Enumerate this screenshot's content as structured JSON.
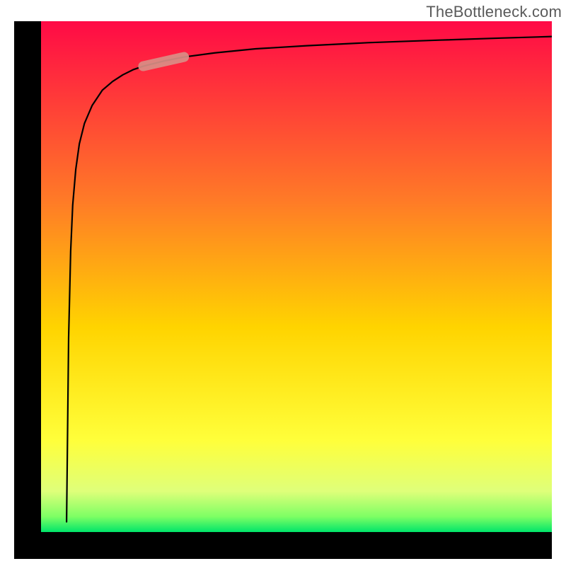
{
  "attribution": "TheBottleneck.com",
  "chart_data": {
    "type": "line",
    "title": "",
    "xlabel": "",
    "ylabel": "",
    "xlim": [
      0,
      100
    ],
    "ylim": [
      0,
      100
    ],
    "grid": false,
    "legend": false,
    "annotations": [],
    "background_gradient": {
      "direction": "vertical_top_to_bottom",
      "stops": [
        {
          "pos": 0.0,
          "color": "#ff0a46"
        },
        {
          "pos": 0.35,
          "color": "#ff7a27"
        },
        {
          "pos": 0.6,
          "color": "#ffd400"
        },
        {
          "pos": 0.82,
          "color": "#ffff3a"
        },
        {
          "pos": 0.92,
          "color": "#dfff7a"
        },
        {
          "pos": 0.97,
          "color": "#7dff64"
        },
        {
          "pos": 1.0,
          "color": "#00e56a"
        }
      ]
    },
    "series": [
      {
        "name": "curve",
        "x": [
          5.0,
          5.2,
          5.4,
          5.8,
          6.2,
          6.8,
          7.5,
          8.5,
          10.0,
          12.0,
          14.0,
          16.0,
          18.0,
          20.0,
          24.0,
          28.0,
          34.0,
          42.0,
          52.0,
          64.0,
          78.0,
          90.0,
          100.0
        ],
        "y": [
          2.0,
          20.0,
          38.0,
          55.0,
          64.0,
          71.0,
          76.0,
          80.0,
          83.5,
          86.5,
          88.2,
          89.5,
          90.5,
          91.2,
          92.2,
          93.0,
          93.8,
          94.6,
          95.2,
          95.8,
          96.3,
          96.7,
          97.0
        ]
      }
    ],
    "highlight": {
      "description": "thick pink segment on curve",
      "color": "#d98e86",
      "x": [
        20.0,
        28.0
      ],
      "y": [
        91.2,
        93.0
      ]
    }
  }
}
